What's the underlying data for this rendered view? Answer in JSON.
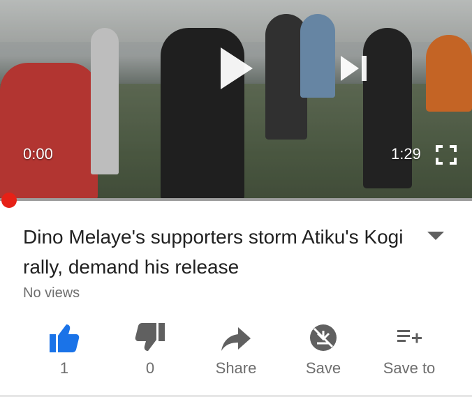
{
  "player": {
    "time_current": "0:00",
    "time_total": "1:29",
    "progress_fraction": 0,
    "accent_color": "#e62117"
  },
  "video": {
    "title": "Dino Melaye's supporters storm Atiku's Kogi rally, demand his release",
    "views": "No views"
  },
  "actions": {
    "like_count": "1",
    "dislike_count": "0",
    "share_label": "Share",
    "save_label": "Save",
    "save_to_label": "Save to",
    "like_color": "#1a73e8",
    "icon_color": "#606060"
  },
  "icons": [
    "play-icon",
    "skip-next-icon",
    "fullscreen-icon",
    "chevron-down-icon",
    "thumbs-up-icon",
    "thumbs-down-icon",
    "share-icon",
    "save-offline-icon",
    "playlist-add-icon"
  ]
}
